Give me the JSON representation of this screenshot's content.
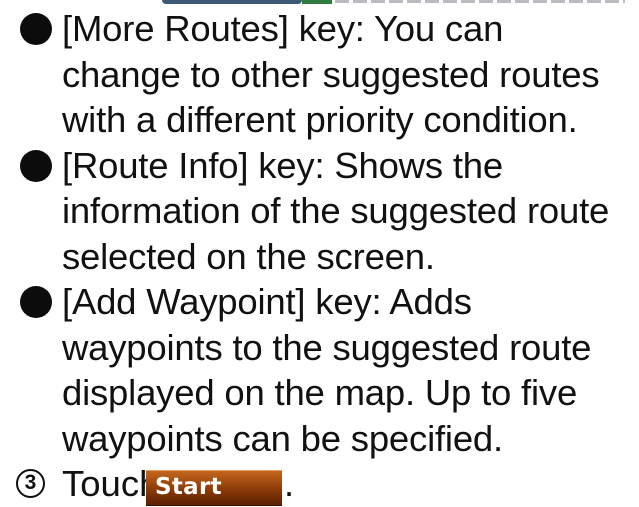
{
  "bullets": [
    {
      "lines": [
        "[More Routes] key: You can",
        "change to other suggested routes",
        "with a different priority condition."
      ]
    },
    {
      "lines": [
        "[Route Info] key: Shows the",
        "information of the suggested route",
        "selected on the screen."
      ]
    },
    {
      "lines": [
        "[Add Waypoint] key: Adds",
        "waypoints to the suggested route",
        "displayed on the map. Up to five",
        "waypoints can be specified."
      ]
    }
  ],
  "step": {
    "number": "3",
    "text": "Touch",
    "button_label": "Start",
    "trailing": "."
  },
  "colors": {
    "text": "#111111",
    "bullet": "#0c0c0c",
    "start_button_top": "#c4661e",
    "start_button_bottom": "#5a2004"
  }
}
